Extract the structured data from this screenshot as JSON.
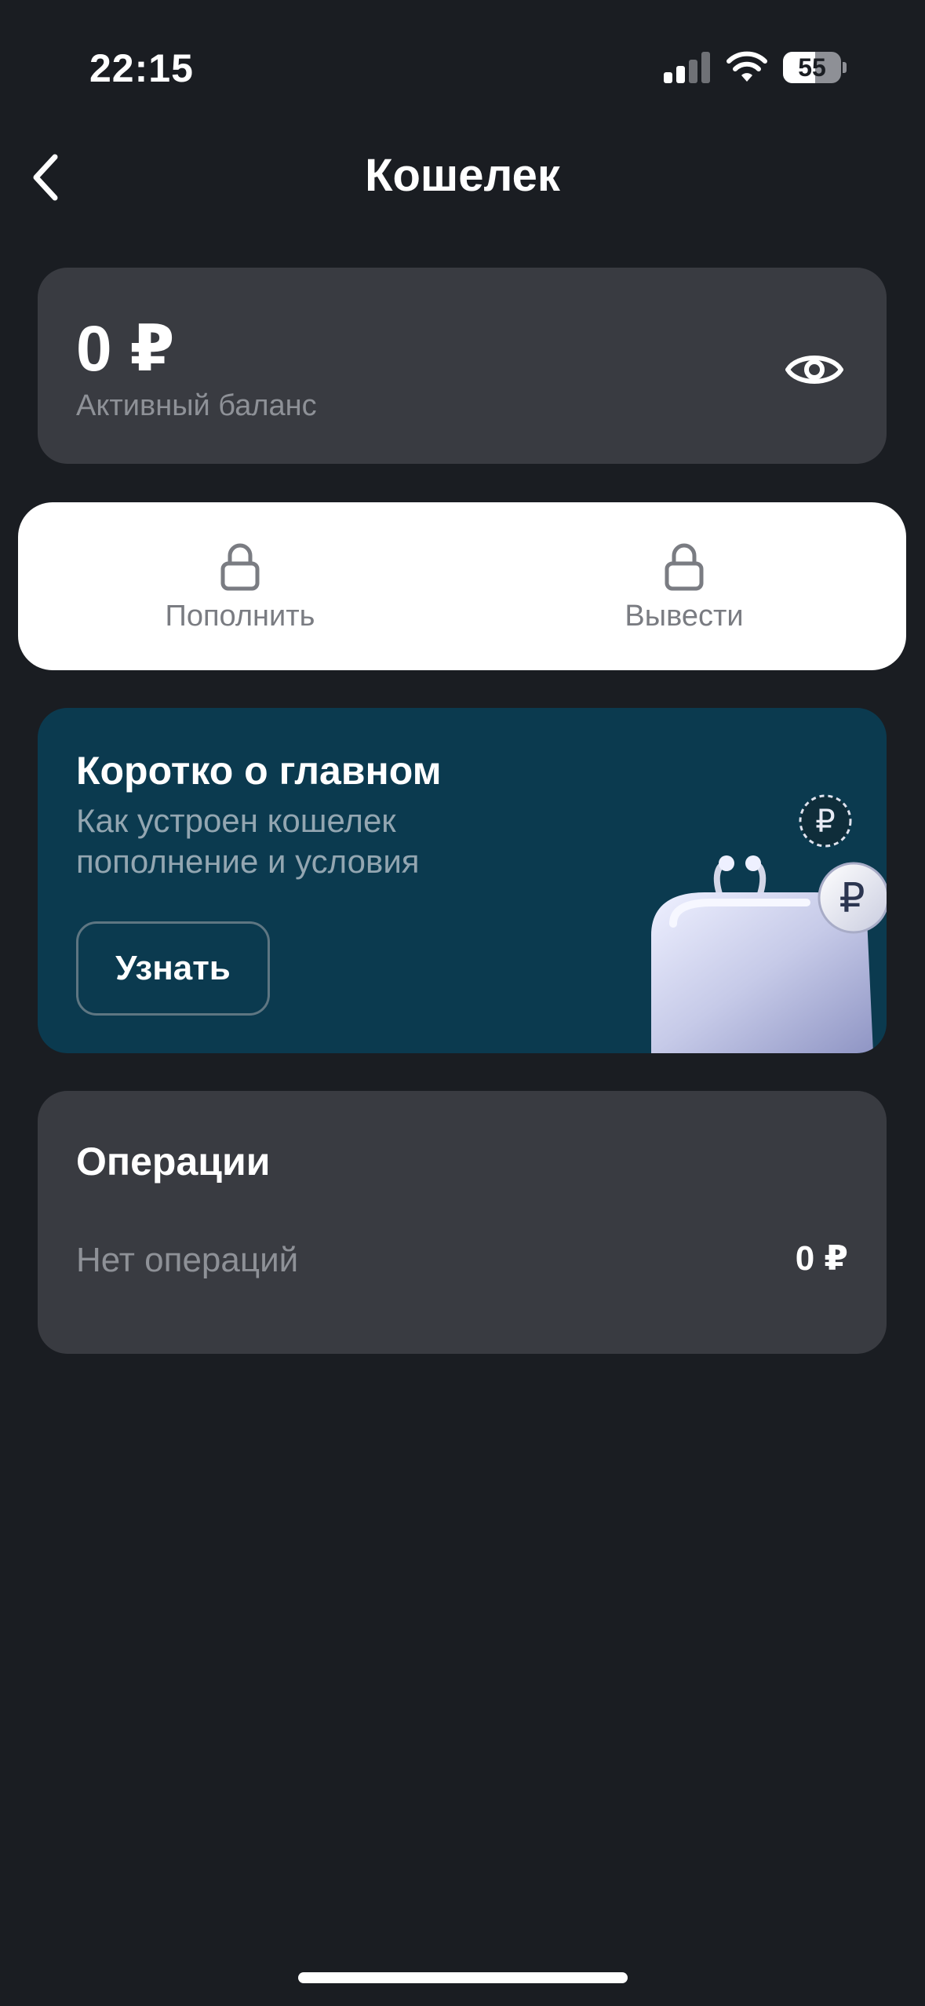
{
  "status_bar": {
    "time": "22:15",
    "battery": "55",
    "battery_level": 0.55,
    "icons": [
      "signal-icon",
      "wifi-icon",
      "battery-icon"
    ]
  },
  "header": {
    "title": "Кошелек",
    "back_icon": "chevron-left-icon"
  },
  "balance": {
    "amount": "0 ₽",
    "label": "Активный баланс",
    "visibility_icon": "eye-icon"
  },
  "actions": [
    {
      "label": "Пополнить",
      "icon": "lock-icon"
    },
    {
      "label": "Вывести",
      "icon": "lock-icon"
    }
  ],
  "promo": {
    "title": "Коротко о главном",
    "text": "Как устроен кошелек пополнение и условия",
    "button_label": "Узнать",
    "illustration": "wallet-with-ruble-coins"
  },
  "operations": {
    "title": "Операции",
    "empty_text": "Нет операций",
    "total": "0 ₽"
  },
  "colors": {
    "background": "#1a1d22",
    "card": "#393b41",
    "promo_background": "#0b3a4f",
    "muted_text": "#8e9197",
    "action_text": "#7a7c82"
  }
}
